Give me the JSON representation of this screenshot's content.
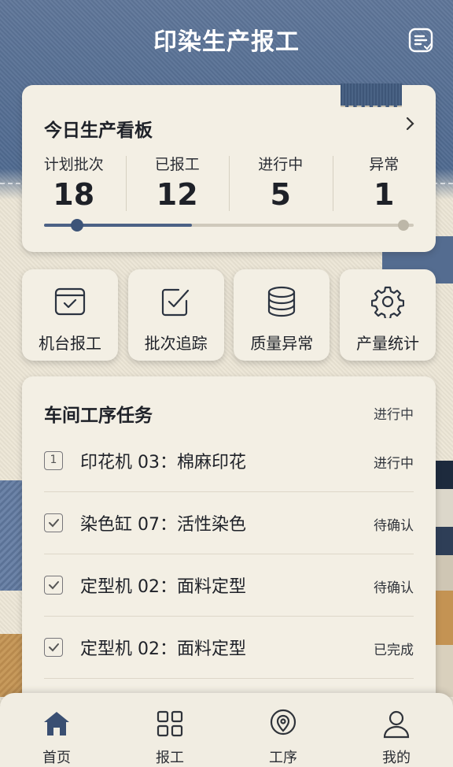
{
  "header": {
    "title": "印染生产报工",
    "icon": "doc-list-icon"
  },
  "dashboard": {
    "title": "今日生产看板",
    "stats": [
      {
        "label": "计划批次",
        "value": "18"
      },
      {
        "label": "已报工",
        "value": "12"
      },
      {
        "label": "进行中",
        "value": "5"
      },
      {
        "label": "异常",
        "value": "1"
      }
    ],
    "progress_fraction": 0.4
  },
  "quick_actions": [
    {
      "label": "机台报工",
      "icon": "machine-report-icon"
    },
    {
      "label": "批次追踪",
      "icon": "checklist-icon"
    },
    {
      "label": "质量异常",
      "icon": "database-icon"
    },
    {
      "label": "产量统计",
      "icon": "gear-icon"
    }
  ],
  "tasks": {
    "title": "车间工序任务",
    "header_status": "进行中",
    "items": [
      {
        "marker": "1",
        "name": "印花机 03：棉麻印花",
        "status": "进行中"
      },
      {
        "marker": "check",
        "name": "染色缸 07：活性染色",
        "status": "待确认"
      },
      {
        "marker": "check",
        "name": "定型机 02：面料定型",
        "status": "待确认"
      },
      {
        "marker": "check",
        "name": "定型机 02：面料定型",
        "status": "已完成"
      }
    ]
  },
  "tabbar": [
    {
      "label": "首页",
      "icon": "home-icon",
      "active": true
    },
    {
      "label": "报工",
      "icon": "grid-icon"
    },
    {
      "label": "工序",
      "icon": "location-pin-icon"
    },
    {
      "label": "我的",
      "icon": "user-icon"
    }
  ],
  "colors": {
    "accent": "#3d5478",
    "card": "#f3efe4",
    "header_fabric": "#556d92"
  }
}
